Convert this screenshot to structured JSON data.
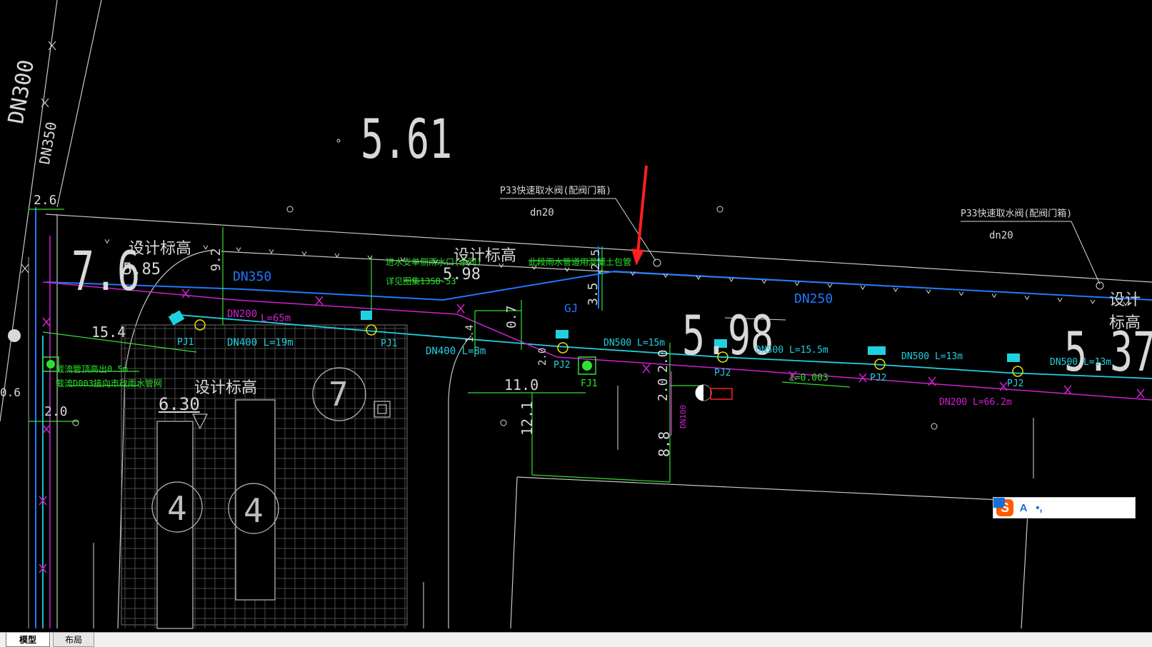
{
  "tabs": [
    {
      "label": "模型",
      "active": true
    },
    {
      "label": "布局",
      "active": false
    }
  ],
  "ime_toolbar": {
    "logo": "S",
    "buttons": [
      "A",
      "•,",
      "mic-icon",
      "keyboard-icon",
      "shirt-icon",
      "grid-icon",
      "gear-icon"
    ]
  },
  "drawing": {
    "elevations": {
      "e561": "5.61",
      "e598_big": "5.98",
      "e537": "5.37",
      "e585": "5.85",
      "e598_small": "5.98",
      "e630": "6.30",
      "e76": "7.6"
    },
    "labels": {
      "design_elev_1": "设计标高",
      "design_elev_2": "设计标高",
      "design_elev_3": "设计标高",
      "design_elev_4": "设计标高",
      "valve_note_1": "P33快速取水阀(配阀门箱)",
      "valve_note_2": "P33快速取水阀(配阀门箱)",
      "dn20_1": "dn20",
      "dn20_2": "dn20",
      "green_note_1": "进水支单侧雨水口(余同)",
      "green_note_2": "详见图集13S8-53",
      "green_note_3": "此段雨水管道用混凝土包管",
      "green_note_4": "截流管顶高出0.5m",
      "green_note_5": "截流D003接向市政雨水管网",
      "dn350_top": "DN350",
      "dn350_vert": "DN350",
      "dn300_vert": "DN300",
      "dn250": "DN250",
      "dn200_1": "DN200",
      "dn200_l65": "L=65m",
      "dn400_l19": "DN400  L=19m",
      "dn400_l8": "DN400  L=8m",
      "dn500_l15": "DN500  L=15m",
      "dn500_l155": "DN500  L=15.5m",
      "dn500_l13": "DN500  L=13m",
      "dn500_l13b": "DN500  L=13m",
      "dn200_l662": "DN200  L=66.2m",
      "dn100": "DN100",
      "slope": "i=0.003",
      "pj1a": "PJ1",
      "pj1b": "PJ1",
      "pj2a": "PJ2",
      "pj2b": "PJ2",
      "pj2c": "PJ2",
      "pj2d": "PJ2",
      "fj1": "FJ1",
      "gj": "GJ"
    },
    "dims": {
      "d26": "2.6",
      "d92": "9.2",
      "d154": "15.4",
      "d20a": "2.0",
      "d07": "0.7",
      "d35": "3.5",
      "d25": "2.5",
      "d11": "11.0",
      "d121": "12.1",
      "d88": "8.8",
      "d20b": "2.0",
      "d20c": "2.0",
      "d14": "1.4",
      "d06": "0.6",
      "d20d": "2.0"
    },
    "lot_numbers": {
      "n7": "7",
      "n4a": "4",
      "n4b": "4"
    }
  },
  "colors": {
    "background": "#000000",
    "pipe_blue": "#1e78ff",
    "pipe_cyan": "#20d0e0",
    "pipe_magenta": "#d020d0",
    "dim_green": "#30e030",
    "text_white": "#d8d8d8",
    "arrow_red": "#ff2020",
    "yellow": "#e8e000"
  }
}
